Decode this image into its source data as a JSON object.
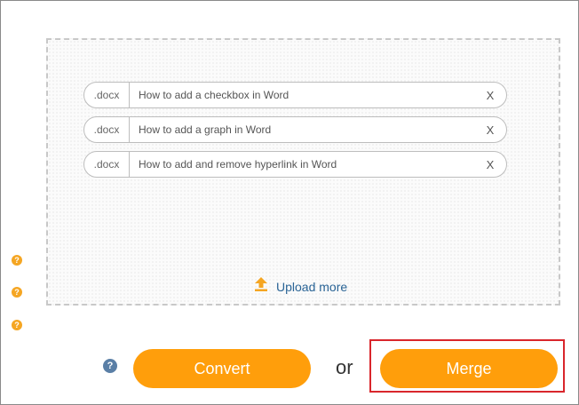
{
  "files": [
    {
      "ext": ".docx",
      "name": "How to add a checkbox in Word",
      "remove": "X"
    },
    {
      "ext": ".docx",
      "name": "How to add a graph in Word",
      "remove": "X"
    },
    {
      "ext": ".docx",
      "name": "How to add and remove hyperlink in Word",
      "remove": "X"
    }
  ],
  "upload": {
    "label": "Upload more",
    "icon": "upload-arrow-icon"
  },
  "help": {
    "glyph": "?"
  },
  "actions": {
    "convert_label": "Convert",
    "or_label": "or",
    "merge_label": "Merge"
  },
  "colors": {
    "accent": "#ff9e0b",
    "help_orange": "#f5a623",
    "help_blue": "#5a7fa6",
    "link": "#2a6496",
    "highlight": "#d9262c"
  }
}
